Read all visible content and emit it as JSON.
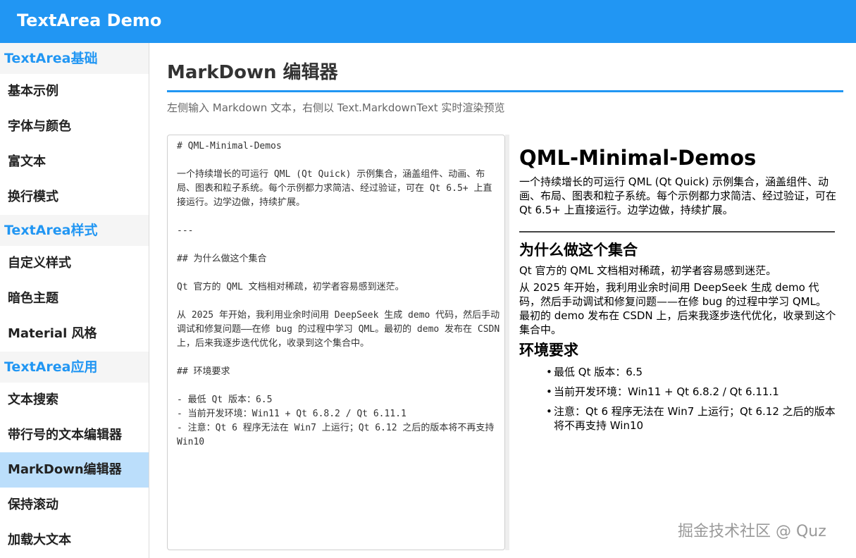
{
  "app": {
    "title": "TextArea Demo"
  },
  "sidebar": {
    "sections": [
      {
        "label": "TextArea基础",
        "items": [
          "基本示例",
          "字体与颜色",
          "富文本",
          "换行模式"
        ]
      },
      {
        "label": "TextArea样式",
        "items": [
          "自定义样式",
          "暗色主题",
          "Material 风格"
        ]
      },
      {
        "label": "TextArea应用",
        "items": [
          "文本搜索",
          "带行号的文本编辑器",
          "MarkDown编辑器",
          "保持滚动",
          "加载大文本"
        ]
      }
    ],
    "selected_item": "MarkDown编辑器"
  },
  "page": {
    "title": "MarkDown 编辑器",
    "subtitle": "左侧输入 Markdown 文本，右侧以 Text.MarkdownText 实时渲染预览",
    "accent_color": "#2196f3"
  },
  "editor": {
    "text": "# QML-Minimal-Demos\n\n一个持续增长的可运行 QML (Qt Quick) 示例集合，涵盖组件、动画、布局、图表和粒子系统。每个示例都力求简洁、经过验证，可在 Qt 6.5+ 上直接运行。边学边做，持续扩展。\n\n---\n\n## 为什么做这个集合\n\nQt 官方的 QML 文档相对稀疏，初学者容易感到迷茫。\n\n从 2025 年开始，我利用业余时间用 DeepSeek 生成 demo 代码，然后手动调试和修复问题——在修 bug 的过程中学习 QML。最初的 demo 发布在 CSDN 上，后来我逐步迭代优化，收录到这个集合中。\n\n## 环境要求\n\n- 最低 Qt 版本：6.5\n- 当前开发环境：Win11 + Qt 6.8.2 / Qt 6.11.1\n- 注意：Qt 6 程序无法在 Win7 上运行；Qt 6.12 之后的版本将不再支持 Win10"
  },
  "preview": {
    "h1": "QML-Minimal-Demos",
    "intro": "一个持续增长的可运行 QML (Qt Quick) 示例集合，涵盖组件、动画、布局、图表和粒子系统。每个示例都力求简洁、经过验证，可在 Qt 6.5+ 上直接运行。边学边做，持续扩展。",
    "h2_why": "为什么做这个集合",
    "why_p1": "Qt 官方的 QML 文档相对稀疏，初学者容易感到迷茫。",
    "why_p2": "从 2025 年开始，我利用业余时间用 DeepSeek 生成 demo 代码，然后手动调试和修复问题——在修 bug 的过程中学习 QML。最初的 demo 发布在 CSDN 上，后来我逐步迭代优化，收录到这个集合中。",
    "h2_env": "环境要求",
    "env_items": [
      "最低 Qt 版本：6.5",
      "当前开发环境：Win11 + Qt 6.8.2 / Qt 6.11.1",
      "注意：Qt 6 程序无法在 Win7 上运行；Qt 6.12 之后的版本将不再支持 Win10"
    ]
  },
  "watermark": "掘金技术社区 @ Quz"
}
